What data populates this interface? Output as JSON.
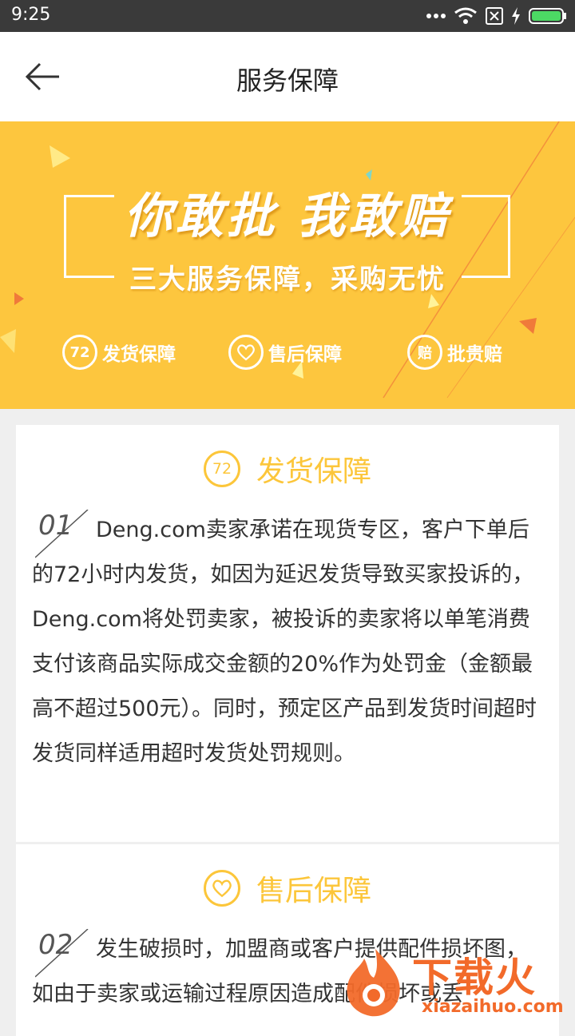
{
  "status_bar": {
    "time": "9:25"
  },
  "header": {
    "title": "服务保障"
  },
  "banner": {
    "headline": "你敢批 我敢赔",
    "subline": "三大服务保障，采购无忧",
    "badges": [
      {
        "icon_text": "72",
        "label": "发货保障"
      },
      {
        "icon": "heart-icon",
        "label": "售后保障"
      },
      {
        "icon_text": "赔",
        "label": "批贵赔"
      }
    ]
  },
  "sections": [
    {
      "icon_text": "72",
      "title": "发货保障",
      "number": "01",
      "text": "Deng.com卖家承诺在现货专区，客户下单后的72小时内发货，如因为延迟发货导致买家投诉的，Deng.com将处罚卖家，被投诉的卖家将以单笔消费支付该商品实际成交金额的20%作为处罚金（金额最高不超过500元）。同时，预定区产品到发货时间超时发货同样适用超时发货处罚规则。"
    },
    {
      "icon": "heart-icon",
      "title": "售后保障",
      "number": "02",
      "text": "发生破损时，加盟商或客户提供配件损坏图，如由于卖家或运输过程原因造成配件损坏或丢"
    }
  ],
  "watermark": {
    "brand": "下载火",
    "url": "xiazaihuo.com"
  },
  "colors": {
    "accent": "#fcc63a",
    "banner": "#fdc63e"
  }
}
